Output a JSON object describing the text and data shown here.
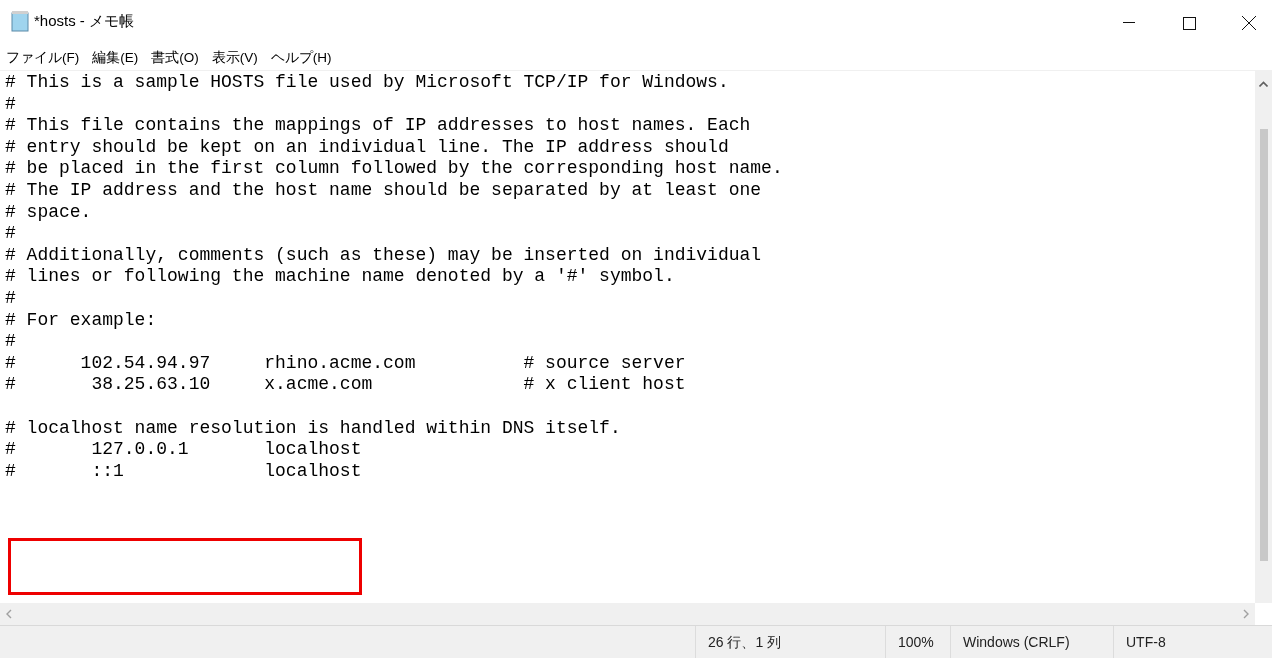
{
  "window": {
    "title": "*hosts - メモ帳"
  },
  "menu": [
    "ファイル(F)",
    "編集(E)",
    "書式(O)",
    "表示(V)",
    "ヘルプ(H)"
  ],
  "editor": {
    "blocks": [
      [
        "# This is a sample HOSTS file used by Microsoft TCP/IP for Windows.",
        "#",
        "# This file contains the mappings of IP addresses to host names. Each",
        "# entry should be kept on an individual line. The IP address should",
        "# be placed in the first column followed by the corresponding host name.",
        "# The IP address and the host name should be separated by at least one",
        "# space.",
        "#",
        "# Additionally, comments (such as these) may be inserted on individual",
        "# lines or following the machine name denoted by a '#' symbol.",
        "#",
        "# For example:",
        "#",
        "#      102.54.94.97     rhino.acme.com          # source server",
        "#       38.25.63.10     x.acme.com              # x client host"
      ],
      [
        "# localhost name resolution is handled within DNS itself.",
        "#       127.0.0.1       localhost",
        "#       ::1             localhost"
      ]
    ]
  },
  "status_bar": [
    "26 行、1 列",
    "100%",
    "Windows (CRLF)",
    "UTF-8"
  ]
}
